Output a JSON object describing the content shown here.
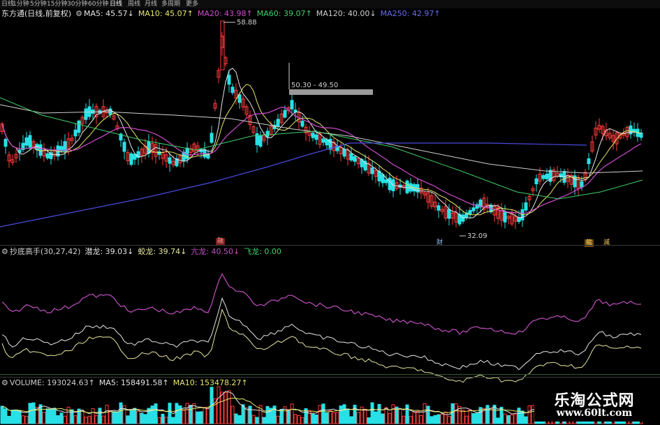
{
  "toolbar": {
    "items": [
      "日线",
      "1分钟",
      "5分钟",
      "15分钟",
      "30分钟",
      "60分钟",
      "日线",
      "周线",
      "月线",
      "多周期",
      "更多"
    ],
    "active_index": 6
  },
  "main_panel": {
    "name": "东方通(日线,前复权)",
    "ma5": "MA5: 45.57↓",
    "ma10": "MA10: 45.07↑",
    "ma20": "MA20: 43.98↑",
    "ma60": "MA60: 39.07↑",
    "ma120": "MA120: 40.00↓",
    "ma250": "MA250: 42.97↑",
    "high_label": "58.88",
    "range_label": "50.30 - 49.50",
    "low_label": "32.09",
    "markers": [
      "融",
      "财",
      "龍",
      "減"
    ]
  },
  "indicator_panel": {
    "name": "抄底高手(30,27,42)",
    "v1": "潜龙: 39.03↓",
    "v2": "蛟龙: 39.74↓",
    "v3": "亢龙: 40.50↓",
    "v4": "飞龙: 0.00"
  },
  "volume_panel": {
    "name": "VOLUME: 193024.63↑",
    "ma5": "MA5: 158491.58↑",
    "ma10": "MA10: 153478.27↑"
  },
  "watermark": {
    "title": "乐淘公式网",
    "url": "www.60lt.com"
  },
  "colors": {
    "up": "#ff3b3b",
    "down": "#27e1e6",
    "ma5": "#e6e6e6",
    "ma10": "#e8e86a",
    "ma20": "#d04dd0",
    "ma60": "#3fd06b",
    "ma120": "#cfcfcf",
    "ma250": "#4a4ae0",
    "ind_purple": "#c050c0",
    "ind_white": "#e6e6e6",
    "ind_yellow": "#e6e6a0",
    "ind_green": "#3fd06b"
  }
}
